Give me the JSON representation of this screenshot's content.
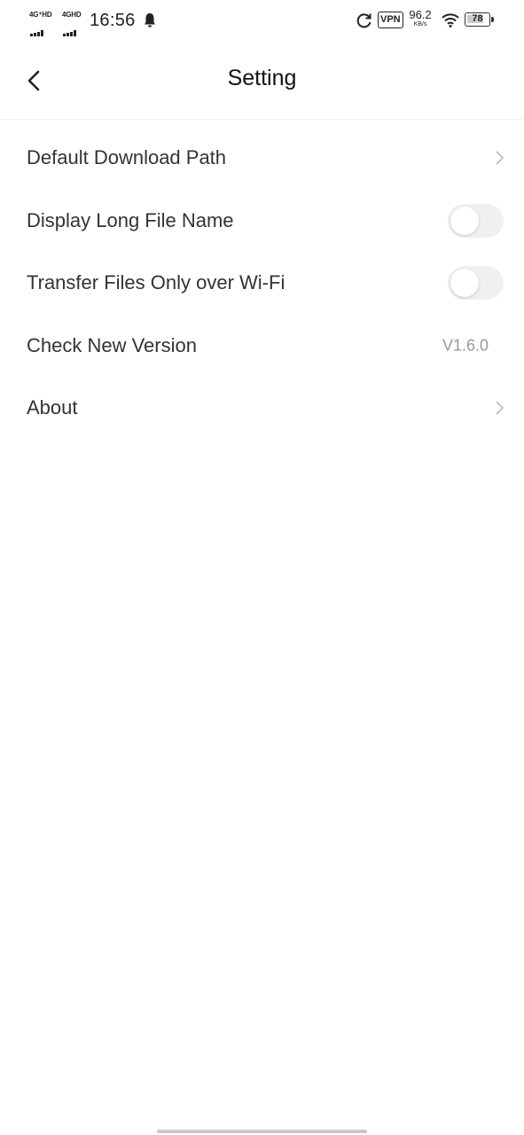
{
  "status_bar": {
    "sim1_network": "4G⁺HD",
    "sim2_network": "4GHD",
    "time": "16:56",
    "vpn_label": "VPN",
    "speed_value": "96.2",
    "speed_unit": "KB/s",
    "battery_level": "78",
    "icons": [
      "signal-icon",
      "signal-icon",
      "notification-bell-icon",
      "sync-icon",
      "wifi-icon",
      "battery-icon"
    ]
  },
  "header": {
    "title": "Setting",
    "back_icon": "chevron-left-icon"
  },
  "settings": {
    "default_download_path": {
      "label": "Default Download Path"
    },
    "display_long_file_name": {
      "label": "Display Long File Name",
      "enabled": false
    },
    "transfer_wifi_only": {
      "label": "Transfer Files Only over Wi-Fi",
      "enabled": false
    },
    "check_new_version": {
      "label": "Check New Version",
      "version": "V1.6.0"
    },
    "about": {
      "label": "About"
    }
  },
  "colors": {
    "toggle_off_track": "#f0f0f0",
    "chevron": "#bbbbbb",
    "version_text": "#999999"
  }
}
